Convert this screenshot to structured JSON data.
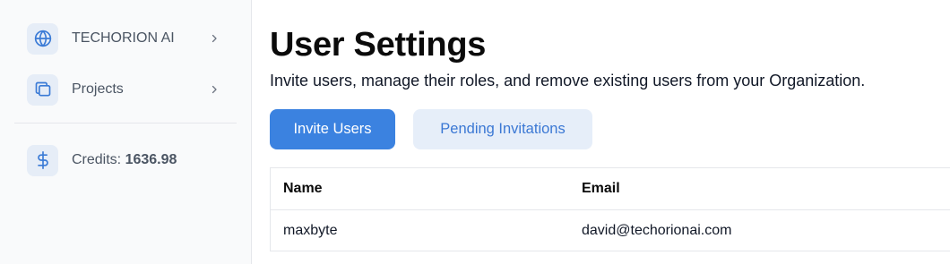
{
  "sidebar": {
    "items": [
      {
        "icon": "globe-icon",
        "label": "TECHORION AI",
        "has_chevron": true
      },
      {
        "icon": "folders-icon",
        "label": "Projects",
        "has_chevron": true
      }
    ],
    "credits": {
      "icon": "dollar-icon",
      "label": "Credits:",
      "value": "1636.98"
    }
  },
  "main": {
    "title": "User Settings",
    "description": "Invite users, manage their roles, and remove existing users from your Organization.",
    "buttons": {
      "invite": "Invite Users",
      "pending": "Pending Invitations"
    },
    "table": {
      "columns": [
        "Name",
        "Email"
      ],
      "rows": [
        [
          "maxbyte",
          "david@techorionai.com"
        ]
      ]
    }
  },
  "colors": {
    "accent": "#3b82e0",
    "accent_soft": "#e6eef9",
    "icon_bg": "#e6edf7",
    "icon_fg": "#3b7bd6"
  }
}
